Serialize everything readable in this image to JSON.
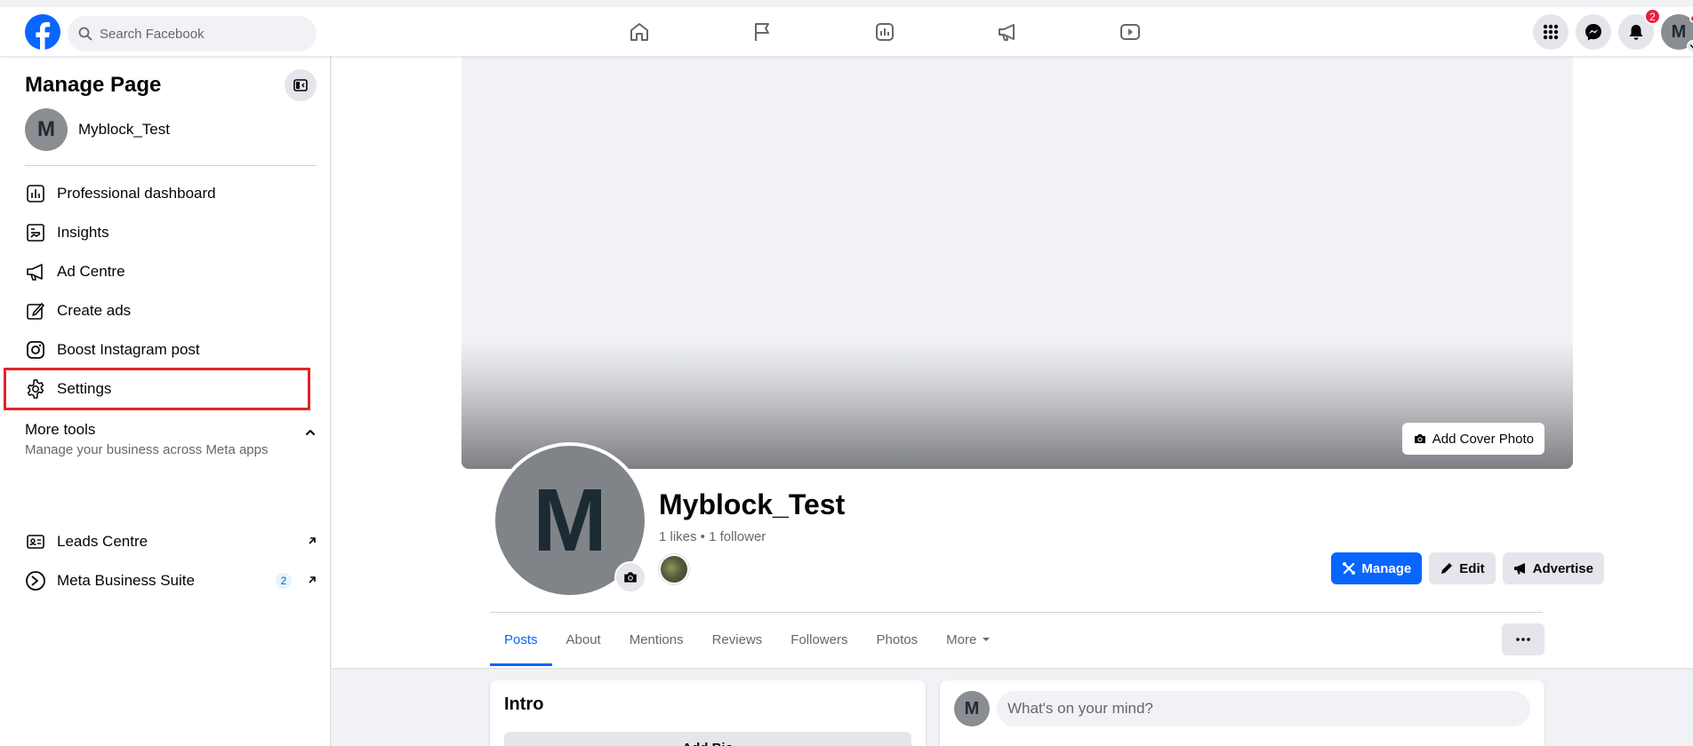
{
  "topbar": {
    "search_placeholder": "Search Facebook",
    "notification_count": "2",
    "account_initial": "M",
    "nav_icons": [
      "home-icon",
      "flag-icon",
      "insights-icon",
      "megaphone-icon",
      "video-icon"
    ]
  },
  "sidebar": {
    "title": "Manage Page",
    "page_initial": "M",
    "page_name": "Myblock_Test",
    "items": [
      {
        "label": "Professional dashboard",
        "icon": "dashboard-icon"
      },
      {
        "label": "Insights",
        "icon": "insights-icon"
      },
      {
        "label": "Ad Centre",
        "icon": "megaphone-icon"
      },
      {
        "label": "Create ads",
        "icon": "pencil-icon"
      },
      {
        "label": "Boost Instagram post",
        "icon": "instagram-icon"
      },
      {
        "label": "Settings",
        "icon": "gear-icon"
      }
    ],
    "more_tools": {
      "title": "More tools",
      "subtitle": "Manage your business across Meta apps"
    },
    "tool_items": [
      {
        "label": "Leads Centre",
        "icon": "leads-icon"
      },
      {
        "label": "Meta Business Suite",
        "icon": "meta-business-suite-icon",
        "count": "2"
      }
    ]
  },
  "profile": {
    "cover_button": "Add Cover Photo",
    "initial": "M",
    "name": "Myblock_Test",
    "stats": "1 likes • 1 follower",
    "actions": {
      "manage": "Manage",
      "edit": "Edit",
      "advertise": "Advertise"
    },
    "tabs": [
      "Posts",
      "About",
      "Mentions",
      "Reviews",
      "Followers",
      "Photos",
      "More"
    ],
    "active_tab": "Posts"
  },
  "intro": {
    "title": "Intro",
    "add_bio": "Add Bio"
  },
  "composer": {
    "initial": "M",
    "placeholder": "What's on your mind?"
  },
  "colors": {
    "brand_blue": "#0866ff",
    "highlight_red": "#e0242b",
    "badge_red": "#e41e3f"
  }
}
